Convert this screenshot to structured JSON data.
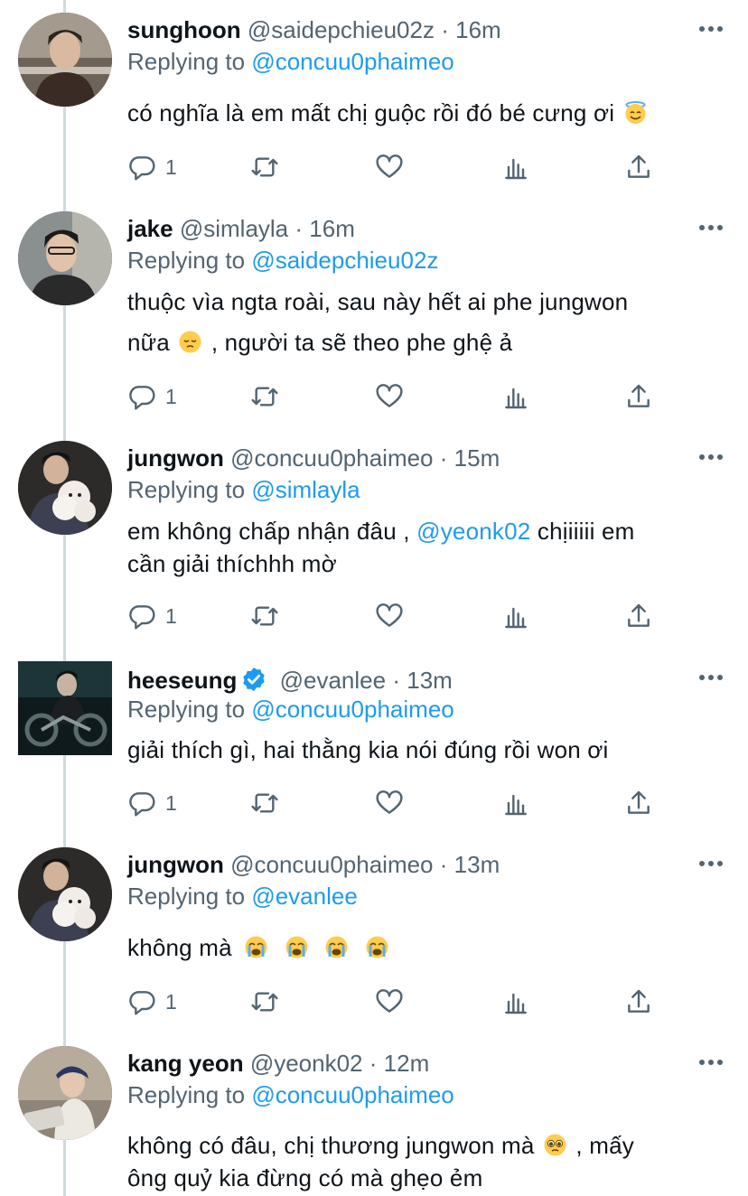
{
  "tweets": [
    {
      "name": "sunghoon",
      "handle": "@saidepchieu02z",
      "time": "16m",
      "replying_label": "Replying to",
      "replying_to": "@concuu0phaimeo",
      "lines": [
        "có nghĩa là em mất chị guộc rồi đó bé cưng ơi"
      ],
      "emoji": "smiling-face-with-halo",
      "reply_count": "1",
      "verified": false
    },
    {
      "name": "jake",
      "handle": "@simlayla",
      "time": "16m",
      "replying_label": "Replying to",
      "replying_to": "@saidepchieu02z",
      "line1": "thuộc vìa ngta roài, sau này hết ai phe jungwon",
      "line2_a": "nữa",
      "line2_b": ", người ta sẽ theo phe ghệ ả",
      "emoji": "pensive-face",
      "reply_count": "1",
      "verified": false
    },
    {
      "name": "jungwon",
      "handle": "@concuu0phaimeo",
      "time": "15m",
      "replying_label": "Replying to",
      "replying_to": "@simlayla",
      "line1_a": "em không chấp nhận đâu ,",
      "line1_mention": "@yeonk02",
      "line1_b": "chịiiiii em",
      "line2": "cần giải thíchhh mờ",
      "reply_count": "1",
      "verified": false
    },
    {
      "name": "heeseung",
      "handle": "@evanlee",
      "time": "13m",
      "replying_label": "Replying to",
      "replying_to": "@concuu0phaimeo",
      "line1": "giải thích gì, hai thằng kia nói đúng rồi won ơi",
      "reply_count": "1",
      "verified": true
    },
    {
      "name": "jungwon",
      "handle": "@concuu0phaimeo",
      "time": "13m",
      "replying_label": "Replying to",
      "replying_to": "@evanlee",
      "line1": "không mà",
      "emoji": "loudly-crying-face x4",
      "reply_count": "1",
      "verified": false
    },
    {
      "name": "kang yeon",
      "handle": "@yeonk02",
      "time": "12m",
      "replying_label": "Replying to",
      "replying_to": "@concuu0phaimeo",
      "line1_a": "không có đâu, chị thương jungwon mà",
      "line1_b": ", mấy",
      "line2": "ông quỷ kia đừng có mà ghẹo ẻm",
      "emoji": "pleading-face",
      "verified": false
    }
  ],
  "separator": "·",
  "colors": {
    "link": "#1d9bf0",
    "secondary_text": "#536471",
    "primary_text": "#0f1419",
    "thread_line": "#cfd9de",
    "verified_badge": "#1d9bf0"
  },
  "icons": [
    "reply-icon",
    "retweet-icon",
    "like-icon",
    "analytics-icon",
    "share-icon",
    "more-icon",
    "verified-badge-icon"
  ]
}
